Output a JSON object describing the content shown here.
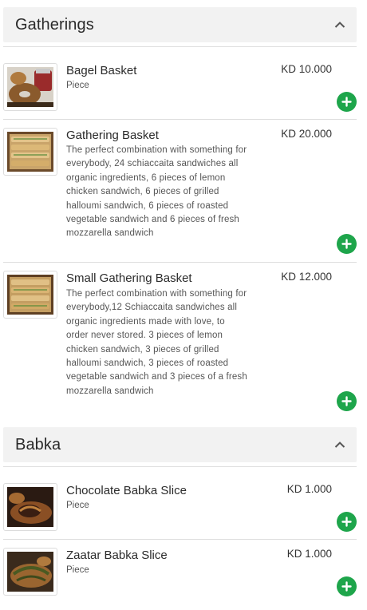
{
  "sections": [
    {
      "title": "Gatherings",
      "items": [
        {
          "name": "Bagel Basket",
          "unit": "Piece",
          "price": "KD 10.000",
          "image_icon": "bagel-basket-photo"
        },
        {
          "name": "Gathering Basket",
          "description": "The perfect combination with something for everybody, 24 schiaccaita sandwiches all organic ingredients, 6 pieces of lemon chicken sandwich, 6 pieces of grilled halloumi sandwich, 6 pieces of roasted vegetable sandwich and 6 pieces of fresh mozzarella sandwich",
          "price": "KD 20.000",
          "image_icon": "sandwich-tray-photo"
        },
        {
          "name": "Small Gathering Basket",
          "description": "The perfect combination with something for everybody,12 Schiaccaita sandwiches all organic ingredients made with love, to order never stored. 3 pieces of lemon chicken sandwich, 3 pieces of grilled halloumi sandwich, 3 pieces of roasted vegetable sandwich and 3 pieces of a fresh mozzarella sandwich",
          "price": "KD 12.000",
          "image_icon": "sandwich-tray-photo"
        }
      ]
    },
    {
      "title": "Babka",
      "items": [
        {
          "name": "Chocolate Babka Slice",
          "unit": "Piece",
          "price": "KD 1.000",
          "image_icon": "chocolate-babka-photo"
        },
        {
          "name": "Zaatar Babka Slice",
          "unit": "Piece",
          "price": "KD 1.000",
          "image_icon": "zaatar-babka-photo"
        }
      ]
    }
  ],
  "colors": {
    "add_button": "#1ea54b",
    "header_bg": "#f2f2f2",
    "divider": "#dedede"
  },
  "icons": {
    "collapse": "chevron-up-icon",
    "add": "plus-icon"
  }
}
